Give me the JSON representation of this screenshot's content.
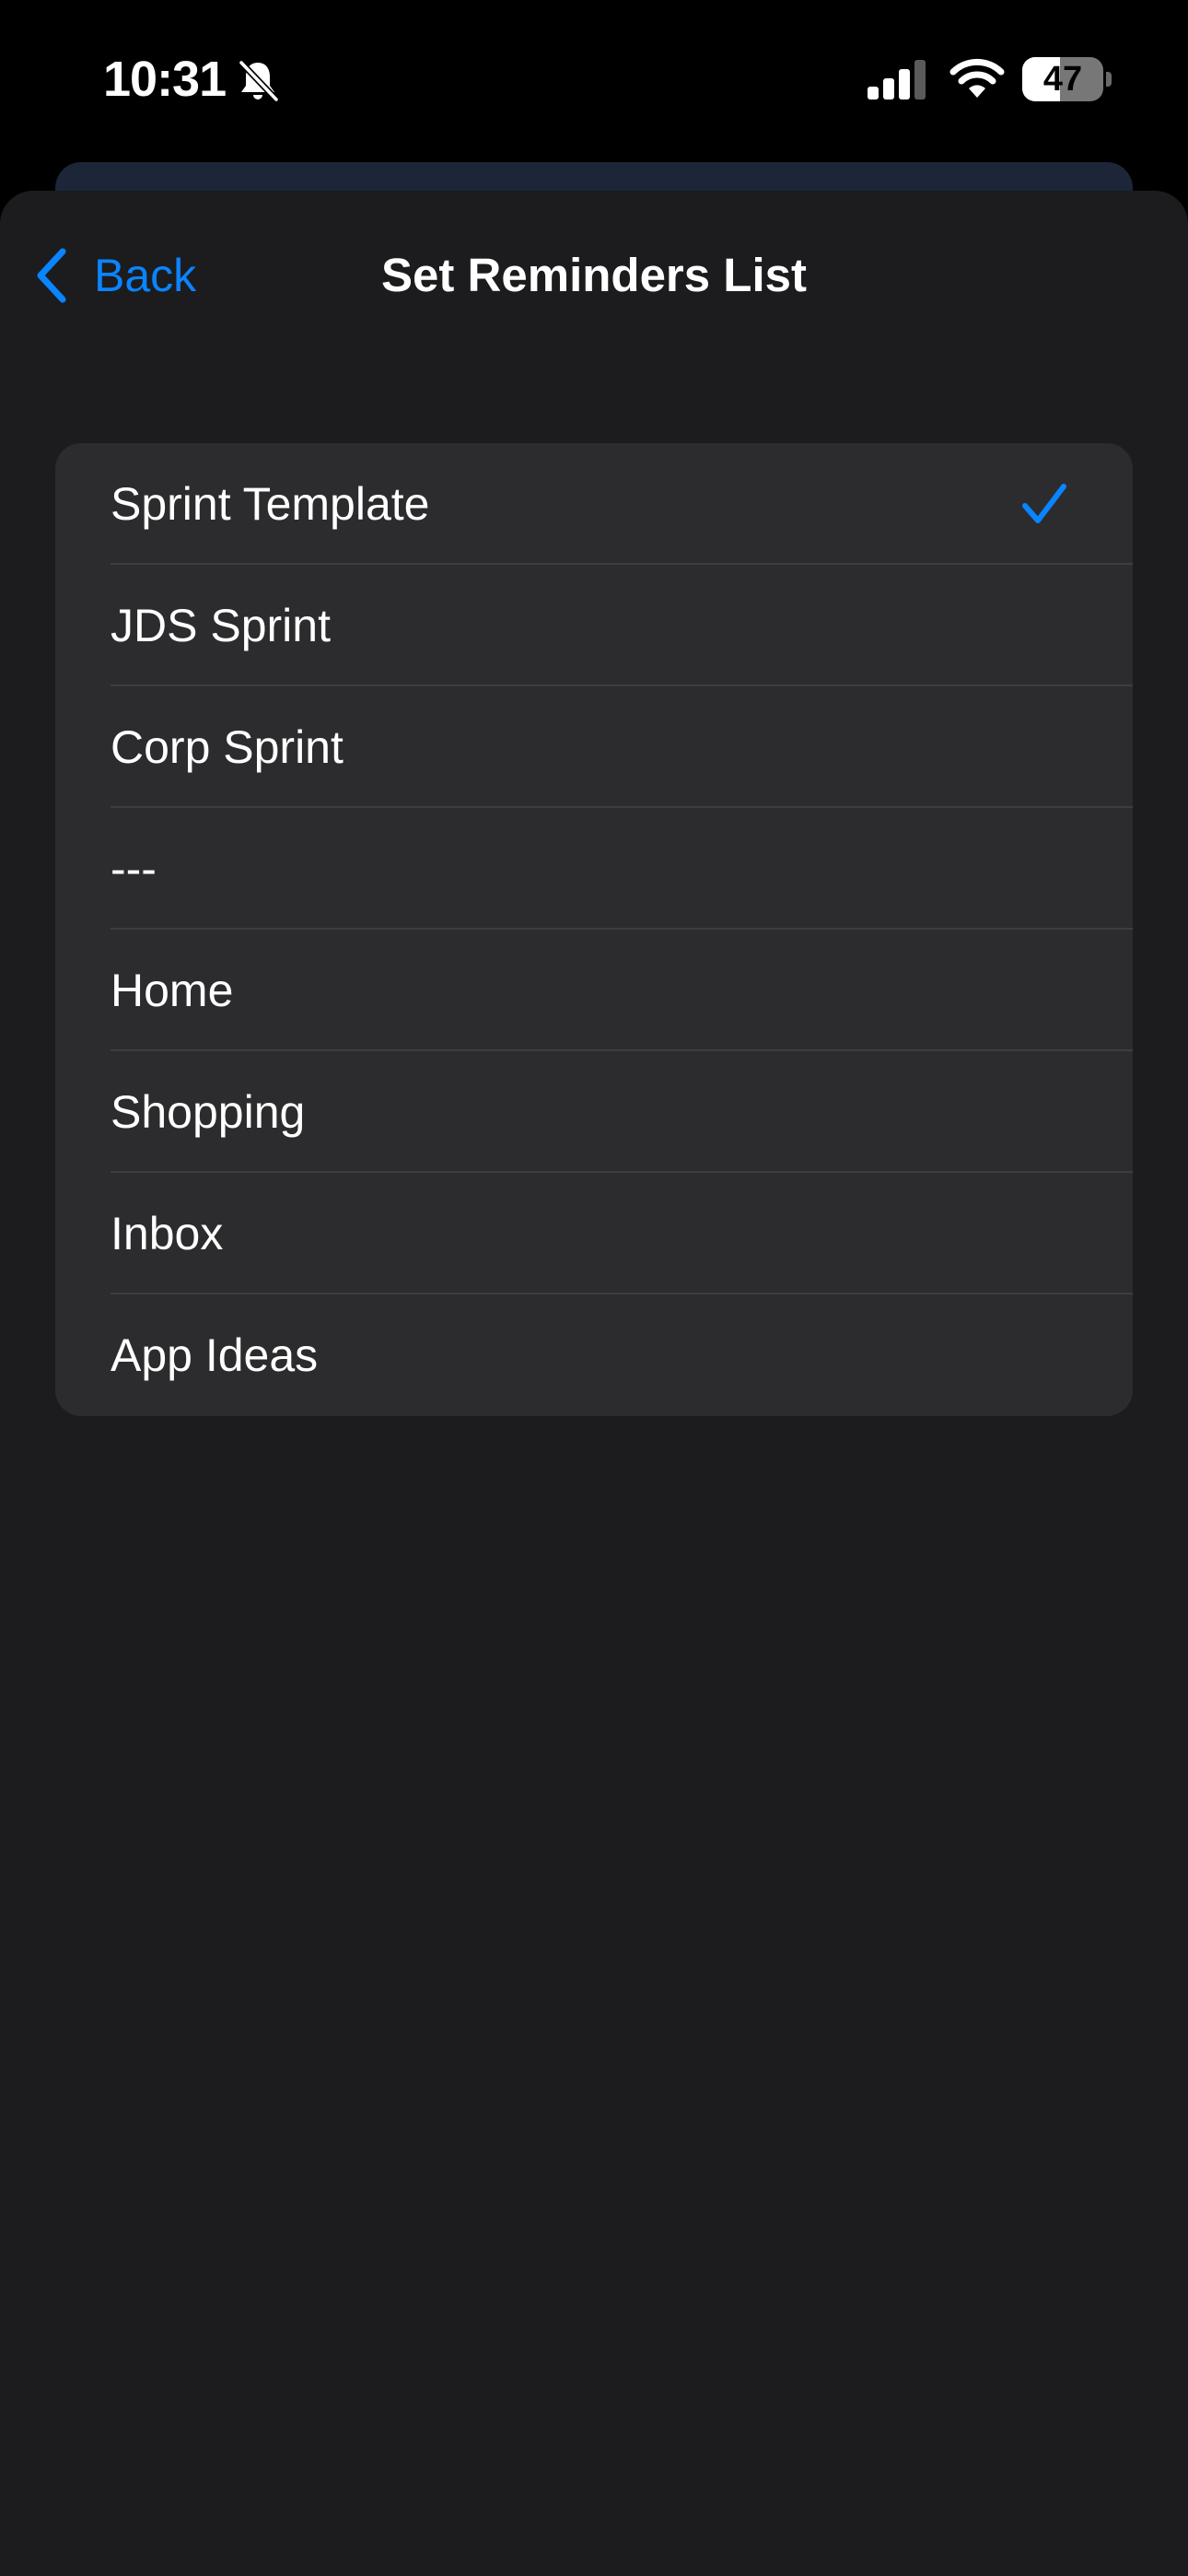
{
  "status_bar": {
    "time": "10:31",
    "battery_level": "47",
    "battery_fraction": 0.47
  },
  "nav": {
    "back_label": "Back",
    "title": "Set Reminders List"
  },
  "list": {
    "items": [
      {
        "label": "Sprint Template",
        "selected": true
      },
      {
        "label": "JDS Sprint",
        "selected": false
      },
      {
        "label": "Corp Sprint",
        "selected": false
      },
      {
        "label": "---",
        "selected": false
      },
      {
        "label": "Home",
        "selected": false
      },
      {
        "label": "Shopping",
        "selected": false
      },
      {
        "label": "Inbox",
        "selected": false
      },
      {
        "label": "App Ideas",
        "selected": false
      }
    ]
  },
  "icons": {
    "bell": "bell-slash-icon",
    "signal": "cellular-signal-icon",
    "wifi": "wifi-icon",
    "battery": "battery-icon",
    "back": "chevron-left-icon",
    "check": "checkmark-icon"
  },
  "colors": {
    "accent": "#0a84ff",
    "sheet_background": "#1c1c1e",
    "group_background": "#2c2c2e",
    "text_primary": "#ffffff"
  }
}
